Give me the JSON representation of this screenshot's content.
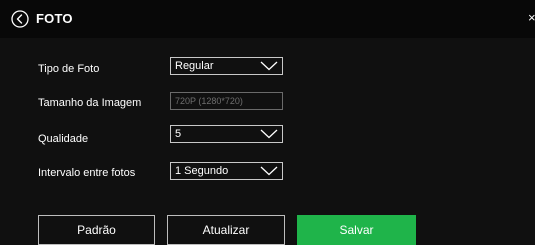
{
  "header": {
    "title": "FOTO",
    "back_icon": "chevron-left-circle-icon",
    "close_label": "×"
  },
  "form": {
    "photo_type": {
      "label": "Tipo de Foto",
      "value": "Regular"
    },
    "image_size": {
      "label": "Tamanho da Imagem",
      "value": "720P (1280*720)"
    },
    "quality": {
      "label": "Qualidade",
      "value": "5"
    },
    "interval": {
      "label": "Intervalo entre fotos",
      "value": "1 Segundo"
    }
  },
  "buttons": {
    "default_label": "Padrão",
    "refresh_label": "Atualizar",
    "save_label": "Salvar"
  },
  "colors": {
    "background": "#101010",
    "accent": "#1fb44a",
    "text": "#ffffff"
  }
}
